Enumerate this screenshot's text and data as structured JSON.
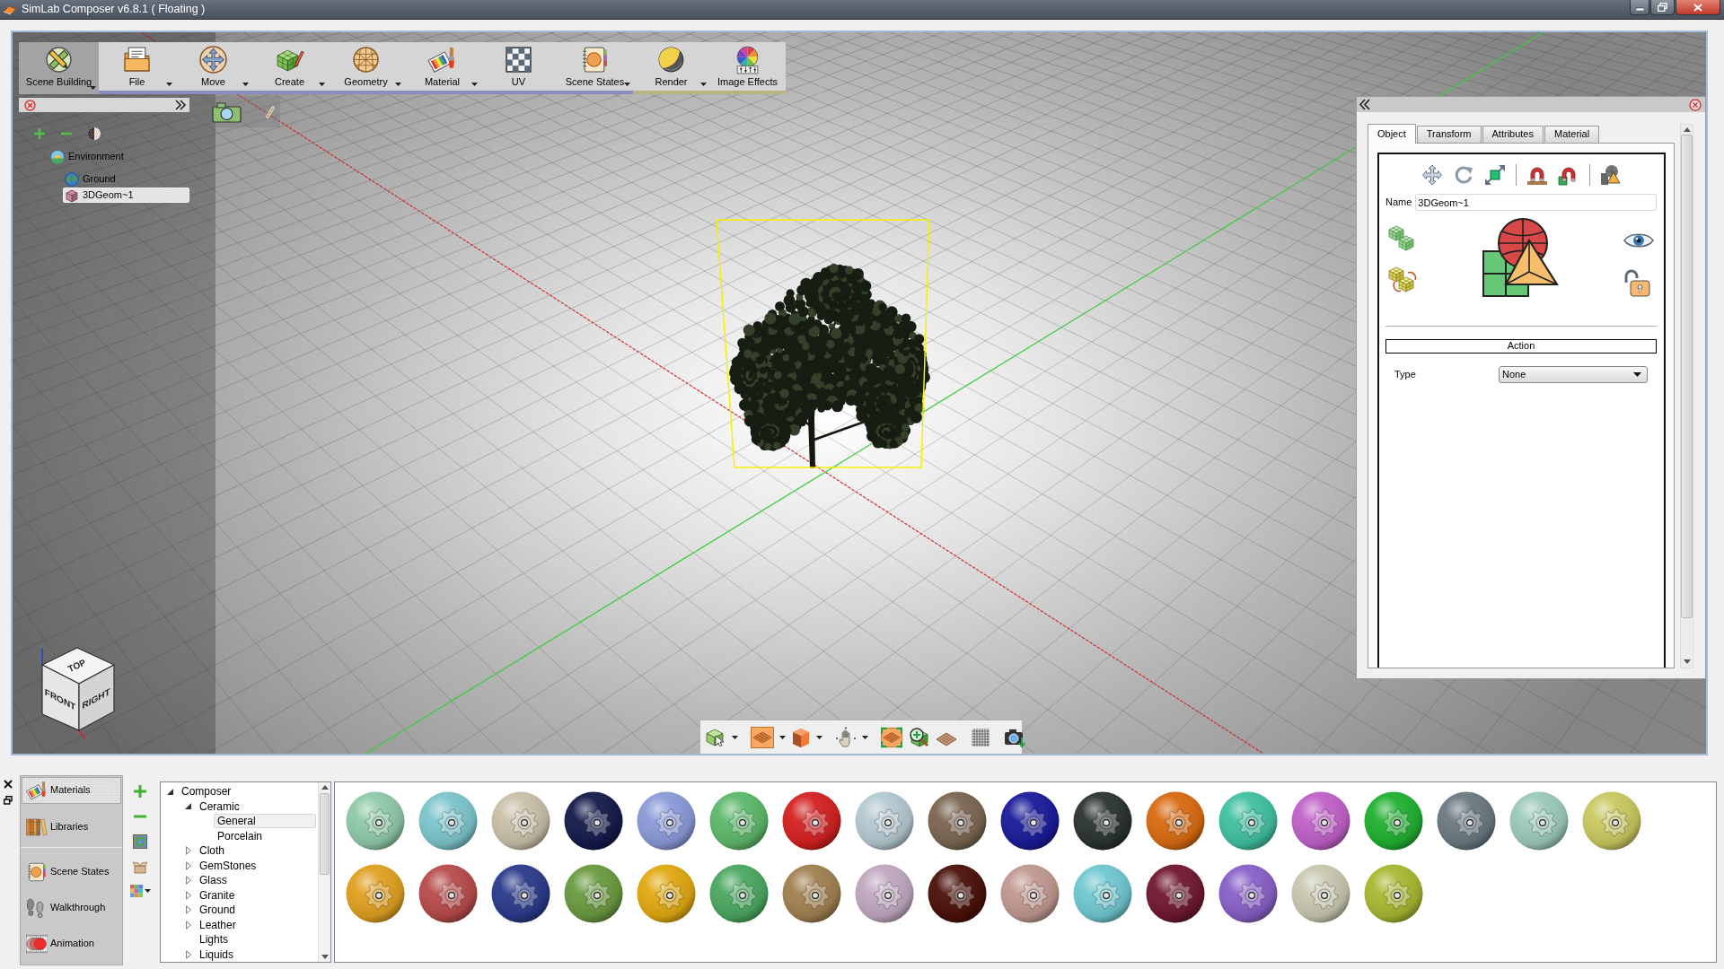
{
  "window": {
    "title": "SimLab Composer v6.8.1 ( Floating )"
  },
  "main_toolbar": [
    {
      "label": "Scene Building",
      "selected": true,
      "dropdown": true
    },
    {
      "label": "File",
      "selected": false,
      "dropdown": true,
      "color": "#8b8bc3"
    },
    {
      "label": "Move",
      "selected": false,
      "dropdown": true,
      "color": "#8b8bc3"
    },
    {
      "label": "Create",
      "selected": false,
      "dropdown": true,
      "color": "#8b8bc3"
    },
    {
      "label": "Geometry",
      "selected": false,
      "dropdown": true,
      "color": "#8b8bc3"
    },
    {
      "label": "Material",
      "selected": false,
      "dropdown": true,
      "color": "#8b8bc3"
    },
    {
      "label": "UV",
      "selected": false,
      "dropdown": false,
      "color": "#8b8bc3"
    },
    {
      "label": "Scene States",
      "selected": false,
      "dropdown": true,
      "color": "#8b8bc3"
    },
    {
      "label": "Render",
      "selected": false,
      "dropdown": true,
      "color": "#b8b47c"
    },
    {
      "label": "Image Effects",
      "selected": false,
      "dropdown": false,
      "color": "#b8b47c"
    }
  ],
  "scene_tree": [
    {
      "label": "Environment",
      "selected": false,
      "children": [
        {
          "label": "Ground",
          "selected": false
        },
        {
          "label": "3DGeom~1",
          "selected": true
        }
      ]
    }
  ],
  "viewport": {
    "view_cube": {
      "faces": [
        "TOP",
        "FRONT",
        "RIGHT"
      ]
    }
  },
  "properties_panel": {
    "tabs": [
      {
        "label": "Object",
        "selected": true
      },
      {
        "label": "Transform",
        "selected": false
      },
      {
        "label": "Attributes",
        "selected": false
      },
      {
        "label": "Material",
        "selected": false
      }
    ],
    "name_label": "Name",
    "name_value": "3DGeom~1",
    "visible": true,
    "locked": false,
    "action_title": "Action",
    "type_label": "Type",
    "type_value": "None"
  },
  "dock": {
    "side_nav": [
      {
        "items": [
          {
            "label": "Materials",
            "selected": true
          },
          {
            "label": "Libraries",
            "selected": false
          }
        ]
      },
      {
        "items": [
          {
            "label": "Scene States",
            "selected": false
          },
          {
            "label": "Walkthrough",
            "selected": false
          },
          {
            "label": "Animation",
            "selected": false
          }
        ]
      }
    ],
    "library_tree": [
      {
        "label": "Composer",
        "selected": false,
        "expanded": true,
        "children": [
          {
            "label": "Ceramic",
            "selected": false,
            "expanded": true,
            "children": [
              {
                "label": "General",
                "selected": true
              },
              {
                "label": "Porcelain",
                "selected": false
              }
            ]
          },
          {
            "label": "Cloth",
            "selected": false,
            "expanded": false
          },
          {
            "label": "GemStones",
            "selected": false,
            "expanded": false
          },
          {
            "label": "Glass",
            "selected": false,
            "expanded": false
          },
          {
            "label": "Granite",
            "selected": false,
            "expanded": false
          },
          {
            "label": "Ground",
            "selected": false,
            "expanded": false
          },
          {
            "label": "Leather",
            "selected": false,
            "expanded": false
          },
          {
            "label": "Lights",
            "selected": false
          },
          {
            "label": "Liquids",
            "selected": false,
            "expanded": false
          }
        ]
      }
    ],
    "materials": [
      {
        "color": "#8fc9a8"
      },
      {
        "color": "#7cc5cc"
      },
      {
        "color": "#c9c0a8"
      },
      {
        "color": "#141a4a"
      },
      {
        "color": "#8a9ad8"
      },
      {
        "color": "#5db86a"
      },
      {
        "color": "#d42020"
      },
      {
        "color": "#b5c8d0"
      },
      {
        "color": "#7a6550"
      },
      {
        "color": "#1a1a9a"
      },
      {
        "color": "#2a3330"
      },
      {
        "color": "#d86a10"
      },
      {
        "color": "#40c0a0"
      },
      {
        "color": "#c060c8"
      },
      {
        "color": "#20b030"
      },
      {
        "color": "#6a7880"
      },
      {
        "color": "#9ccab8"
      },
      {
        "color": "#c8c860"
      },
      {
        "color": "#e0a020"
      },
      {
        "color": "#b84a4a"
      },
      {
        "color": "#2a3a8a"
      },
      {
        "color": "#6a9a40"
      },
      {
        "color": "#e0a810"
      },
      {
        "color": "#4aa860"
      },
      {
        "color": "#a08050"
      },
      {
        "color": "#c0a8c0"
      },
      {
        "color": "#4a1008"
      },
      {
        "color": "#c09890"
      },
      {
        "color": "#70c8d0"
      },
      {
        "color": "#701830"
      },
      {
        "color": "#8860c8"
      },
      {
        "color": "#c8c8b0"
      },
      {
        "color": "#a8b830"
      }
    ]
  }
}
